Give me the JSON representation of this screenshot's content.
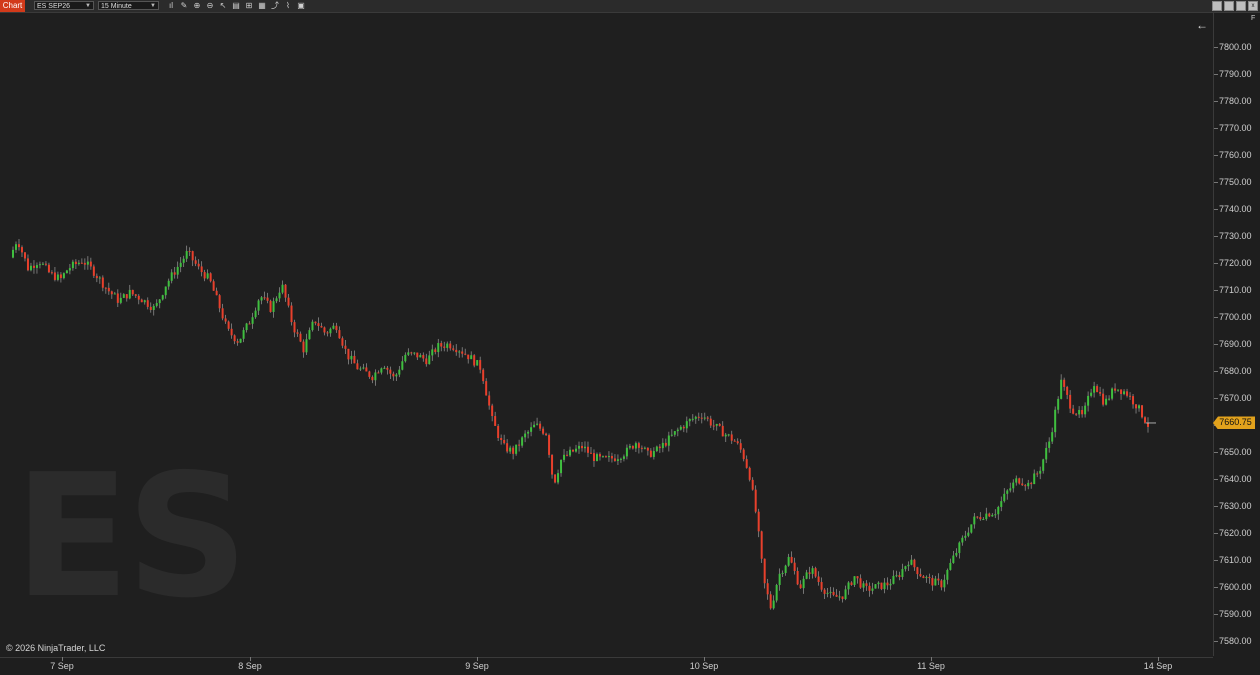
{
  "toolbar": {
    "tab_label": "Chart",
    "instrument": "ES SEP26",
    "timeframe": "15 Minute",
    "tools": [
      "bar-chart-icon",
      "pencil-icon",
      "zoom-in-icon",
      "zoom-out-icon",
      "pointer-icon",
      "crosshair-icon",
      "properties-icon",
      "indicators-icon",
      "strategies-icon",
      "share-icon",
      "snapshot-icon"
    ]
  },
  "window": {
    "minimize": "",
    "restore": "",
    "close": "x"
  },
  "watermark": "ES",
  "copyright": "© 2026 NinjaTrader, LLC",
  "axis_flag": "F",
  "last_price": "7660.75",
  "colors": {
    "up": "#3fbf3f",
    "down": "#e8402c",
    "wick": "#9a9a9a",
    "price_tag": "#e2a21c"
  },
  "chart_data": {
    "type": "candlestick",
    "title": "",
    "instrument": "ES SEP26",
    "interval": "15 Minute",
    "y_ticks": [
      "7800.00",
      "7790.00",
      "7780.00",
      "7770.00",
      "7760.00",
      "7750.00",
      "7740.00",
      "7730.00",
      "7720.00",
      "7710.00",
      "7700.00",
      "7690.00",
      "7680.00",
      "7670.00",
      "7660.00",
      "7650.00",
      "7640.00",
      "7630.00",
      "7620.00",
      "7610.00",
      "7600.00",
      "7590.00",
      "7580.00"
    ],
    "ylim": [
      7578,
      7808
    ],
    "x_labels": [
      "7 Sep",
      "8 Sep",
      "9 Sep",
      "10 Sep",
      "11 Sep",
      "14 Sep"
    ],
    "last": 7660.75,
    "close_path": [
      [
        0,
        7722
      ],
      [
        0.02,
        7729
      ],
      [
        0.05,
        7718
      ],
      [
        0.08,
        7721
      ],
      [
        0.11,
        7716
      ],
      [
        0.14,
        7714
      ],
      [
        0.16,
        7718
      ],
      [
        0.2,
        7721
      ],
      [
        0.23,
        7717
      ],
      [
        0.27,
        7710
      ],
      [
        0.3,
        7706
      ],
      [
        0.33,
        7709
      ],
      [
        0.36,
        7707
      ],
      [
        0.4,
        7703
      ],
      [
        0.43,
        7712
      ],
      [
        0.46,
        7718
      ],
      [
        0.49,
        7724
      ],
      [
        0.52,
        7718
      ],
      [
        0.55,
        7714
      ],
      [
        0.58,
        7703
      ],
      [
        0.6,
        7695
      ],
      [
        0.63,
        7691
      ],
      [
        0.66,
        7698
      ],
      [
        0.69,
        7708
      ],
      [
        0.72,
        7703
      ],
      [
        0.75,
        7712
      ],
      [
        0.78,
        7697
      ],
      [
        0.81,
        7688
      ],
      [
        0.84,
        7699
      ],
      [
        0.87,
        7694
      ],
      [
        0.9,
        7697
      ],
      [
        0.93,
        7686
      ],
      [
        0.96,
        7681
      ],
      [
        1.0,
        7678
      ],
      [
        1.03,
        7683
      ],
      [
        1.06,
        7677
      ],
      [
        1.09,
        7686
      ],
      [
        1.12,
        7686
      ],
      [
        1.15,
        7684
      ],
      [
        1.18,
        7689
      ],
      [
        1.21,
        7690
      ],
      [
        1.24,
        7688
      ],
      [
        1.27,
        7685
      ],
      [
        1.3,
        7681
      ],
      [
        1.33,
        7662
      ],
      [
        1.36,
        7652
      ],
      [
        1.39,
        7650
      ],
      [
        1.42,
        7656
      ],
      [
        1.45,
        7660
      ],
      [
        1.48,
        7657
      ],
      [
        1.5,
        7638
      ],
      [
        1.52,
        7647
      ],
      [
        1.55,
        7650
      ],
      [
        1.58,
        7652
      ],
      [
        1.61,
        7648
      ],
      [
        1.64,
        7647
      ],
      [
        1.67,
        7648
      ],
      [
        1.7,
        7650
      ],
      [
        1.73,
        7654
      ],
      [
        1.76,
        7649
      ],
      [
        1.79,
        7651
      ],
      [
        1.82,
        7655
      ],
      [
        1.85,
        7659
      ],
      [
        1.88,
        7662
      ],
      [
        1.91,
        7664
      ],
      [
        1.94,
        7660
      ],
      [
        1.97,
        7657
      ],
      [
        2.0,
        7654
      ],
      [
        2.02,
        7650
      ],
      [
        2.04,
        7642
      ],
      [
        2.06,
        7626
      ],
      [
        2.08,
        7602
      ],
      [
        2.1,
        7592
      ],
      [
        2.12,
        7604
      ],
      [
        2.15,
        7611
      ],
      [
        2.18,
        7600
      ],
      [
        2.21,
        7607
      ],
      [
        2.24,
        7600
      ],
      [
        2.27,
        7596
      ],
      [
        2.3,
        7597
      ],
      [
        2.33,
        7604
      ],
      [
        2.36,
        7599
      ],
      [
        2.39,
        7600
      ],
      [
        2.42,
        7601
      ],
      [
        2.45,
        7604
      ],
      [
        2.48,
        7610
      ],
      [
        2.51,
        7605
      ],
      [
        2.54,
        7602
      ],
      [
        2.57,
        7601
      ],
      [
        2.6,
        7610
      ],
      [
        2.63,
        7618
      ],
      [
        2.66,
        7625
      ],
      [
        2.69,
        7627
      ],
      [
        2.72,
        7628
      ],
      [
        2.75,
        7635
      ],
      [
        2.78,
        7640
      ],
      [
        2.81,
        7638
      ],
      [
        2.84,
        7643
      ],
      [
        2.87,
        7655
      ],
      [
        2.9,
        7676
      ],
      [
        2.93,
        7666
      ],
      [
        2.96,
        7663
      ],
      [
        2.99,
        7676
      ],
      [
        3.02,
        7668
      ],
      [
        3.05,
        7674
      ],
      [
        3.08,
        7672
      ],
      [
        3.11,
        7667
      ],
      [
        3.14,
        7660
      ]
    ]
  }
}
